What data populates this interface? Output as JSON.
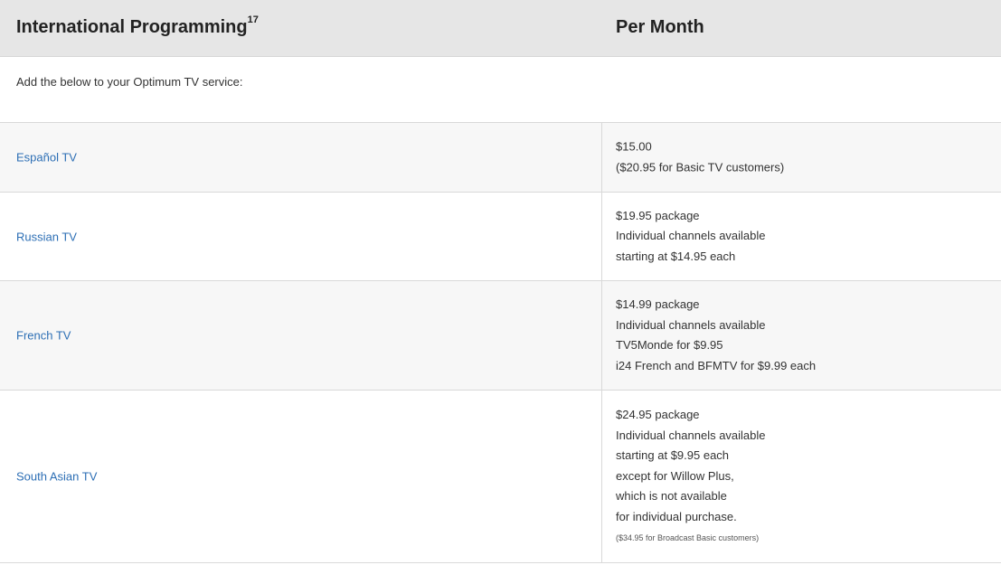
{
  "header": {
    "title": "International Programming",
    "footnote": "17",
    "price_column": "Per Month"
  },
  "intro": "Add the below to your Optimum TV service:",
  "rows": [
    {
      "name": "Español TV",
      "lines": [
        "$15.00",
        "($20.95 for Basic TV customers)"
      ]
    },
    {
      "name": "Russian TV",
      "lines": [
        "$19.95 package",
        "Individual channels available",
        "starting at $14.95 each"
      ]
    },
    {
      "name": "French TV",
      "lines": [
        "$14.99 package",
        "Individual channels available",
        "TV5Monde for $9.95",
        "i24 French and BFMTV for $9.99 each"
      ]
    },
    {
      "name": "South Asian TV",
      "lines": [
        "$24.95 package",
        "Individual channels available",
        "starting at $9.95 each",
        "except for Willow Plus,",
        "which is not available",
        "for individual purchase."
      ],
      "note": "($34.95 for Broadcast Basic customers)"
    }
  ]
}
